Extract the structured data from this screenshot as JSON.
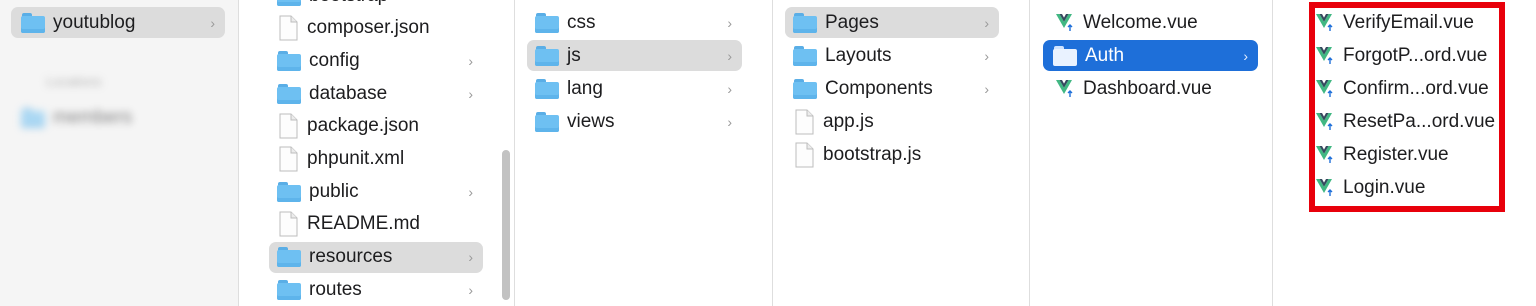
{
  "sidebar": {
    "selected": {
      "label": "youtublog",
      "icon": "folder-icon"
    },
    "section_heading": "Locations",
    "blurred_item": {
      "label": "members",
      "icon": "folder-icon"
    }
  },
  "col1": {
    "items": [
      {
        "label": "bootstrap",
        "kind": "folder",
        "chevron": "›"
      },
      {
        "label": "composer.json",
        "kind": "file"
      },
      {
        "label": "config",
        "kind": "folder",
        "chevron": "›"
      },
      {
        "label": "database",
        "kind": "folder",
        "chevron": "›"
      },
      {
        "label": "package.json",
        "kind": "file"
      },
      {
        "label": "phpunit.xml",
        "kind": "file"
      },
      {
        "label": "public",
        "kind": "folder",
        "chevron": "›"
      },
      {
        "label": "README.md",
        "kind": "file"
      },
      {
        "label": "resources",
        "kind": "folder",
        "chevron": "›",
        "selected": true
      },
      {
        "label": "routes",
        "kind": "folder",
        "chevron": "›"
      }
    ]
  },
  "col2": {
    "items": [
      {
        "label": "css",
        "kind": "folder",
        "chevron": "›"
      },
      {
        "label": "js",
        "kind": "folder",
        "chevron": "›",
        "selected": true
      },
      {
        "label": "lang",
        "kind": "folder",
        "chevron": "›"
      },
      {
        "label": "views",
        "kind": "folder",
        "chevron": "›"
      }
    ]
  },
  "col3": {
    "items": [
      {
        "label": "Pages",
        "kind": "folder",
        "chevron": "›",
        "selected": true
      },
      {
        "label": "Layouts",
        "kind": "folder",
        "chevron": "›"
      },
      {
        "label": "Components",
        "kind": "folder",
        "chevron": "›"
      },
      {
        "label": "app.js",
        "kind": "file"
      },
      {
        "label": "bootstrap.js",
        "kind": "file"
      }
    ]
  },
  "col4": {
    "items": [
      {
        "label": "Welcome.vue",
        "kind": "vue"
      },
      {
        "label": "Auth",
        "kind": "folder",
        "chevron": "›",
        "active": true
      },
      {
        "label": "Dashboard.vue",
        "kind": "vue"
      }
    ]
  },
  "col5": {
    "items": [
      {
        "label": "VerifyEmail.vue",
        "kind": "vue"
      },
      {
        "label": "ForgotP...ord.vue",
        "kind": "vue"
      },
      {
        "label": "Confirm...ord.vue",
        "kind": "vue"
      },
      {
        "label": "ResetPa...ord.vue",
        "kind": "vue"
      },
      {
        "label": "Register.vue",
        "kind": "vue"
      },
      {
        "label": "Login.vue",
        "kind": "vue"
      }
    ]
  },
  "colors": {
    "highlight_box": "#e8000b",
    "selection_blue": "#1e6fd9",
    "selection_grey": "#dcdcdc"
  }
}
